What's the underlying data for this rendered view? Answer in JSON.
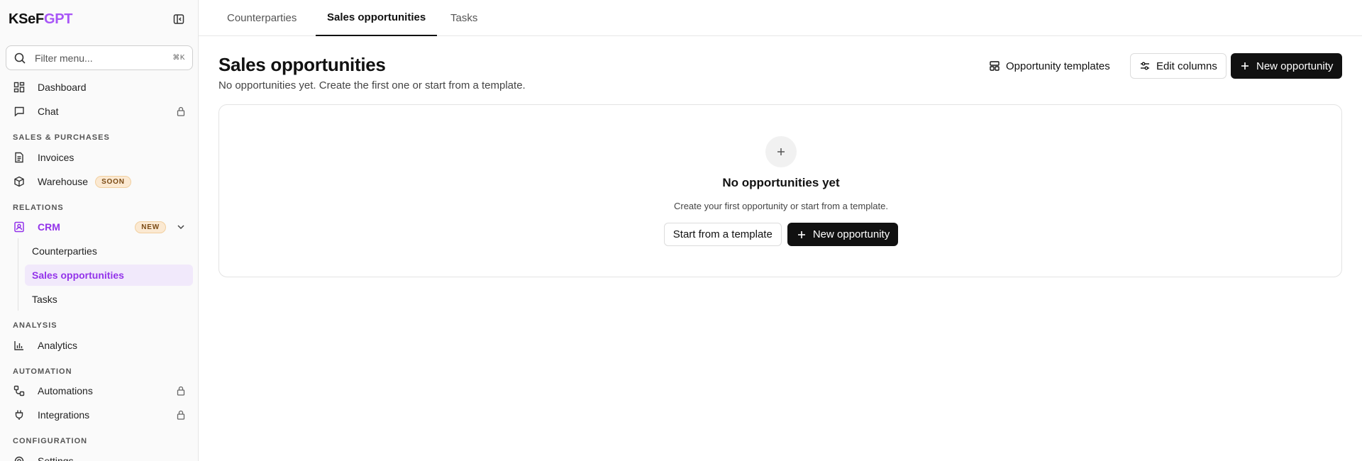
{
  "brand": {
    "part1": "KSeF",
    "part2": "GPT",
    "accent": "#a855f7"
  },
  "search": {
    "placeholder": "Filter menu...",
    "shortcut": "⌘K"
  },
  "nav": {
    "dashboard": "Dashboard",
    "chat": "Chat",
    "sections": {
      "sales": "SALES & PURCHASES",
      "relations": "RELATIONS",
      "analysis": "ANALYSIS",
      "automation": "AUTOMATION",
      "configuration": "CONFIGURATION"
    },
    "invoices": "Invoices",
    "warehouse": "Warehouse",
    "warehouse_badge": "SOON",
    "crm": "CRM",
    "crm_badge": "NEW",
    "crm_children": [
      "Counterparties",
      "Sales opportunities",
      "Tasks"
    ],
    "analytics": "Analytics",
    "automations": "Automations",
    "integrations": "Integrations",
    "settings": "Settings"
  },
  "tabs": [
    "Counterparties",
    "Sales opportunities",
    "Tasks"
  ],
  "active_tab": "Sales opportunities",
  "page": {
    "title": "Sales opportunities",
    "subtitle": "No opportunities yet. Create the first one or start from a template.",
    "actions": {
      "templates": "Opportunity templates",
      "edit_columns": "Edit columns",
      "new_opportunity": "New opportunity"
    }
  },
  "empty_state": {
    "title": "No opportunities yet",
    "description": "Create your first opportunity or start from a template.",
    "start_template": "Start from a template",
    "new_opportunity": "New opportunity"
  },
  "colors": {
    "accent": "#9333ea",
    "primary_button": "#111111",
    "active_sub_bg": "#f1e9fb"
  }
}
